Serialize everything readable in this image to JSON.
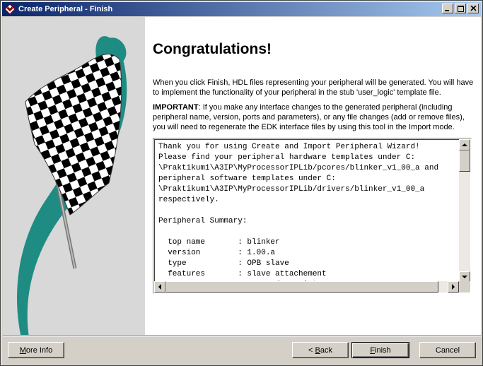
{
  "window": {
    "title": "Create Peripheral - Finish",
    "controls": [
      "minimize-icon",
      "maximize-icon",
      "close-icon"
    ]
  },
  "main": {
    "heading": "Congratulations!",
    "para1": "When you click Finish, HDL files representing your peripheral will be generated. You will have to implement the functionality of your peripheral in the stub 'user_logic' template file.",
    "important_label": "IMPORTANT",
    "important_text": ": If you make any interface changes to the generated peripheral (including peripheral name, version, ports and parameters), or any file changes (add or remove files), you will need to regenerate the EDK interface files by using this tool in the Import mode.",
    "summary": "Thank you for using Create and Import Peripheral Wizard!\nPlease find your peripheral hardware templates under C:\n\\Praktikum1\\A3IP\\MyProcessorIPLib/pcores/blinker_v1_00_a and\nperipheral software templates under C:\n\\Praktikum1\\A3IP\\MyProcessorIPLib/drivers/blinker_v1_00_a\nrespectively.\n\nPeripheral Summary:\n\n  top name       : blinker\n  version        : 1.00.a\n  type           : OPB slave\n  features       : slave attachement\n                   user s/w registers"
  },
  "footer": {
    "more_info": {
      "prefix": "",
      "underline": "M",
      "rest": "ore Info"
    },
    "back": {
      "prefix": "< ",
      "underline": "B",
      "rest": "ack"
    },
    "finish": {
      "prefix": "",
      "underline": "F",
      "rest": "inish"
    },
    "cancel": "Cancel"
  }
}
